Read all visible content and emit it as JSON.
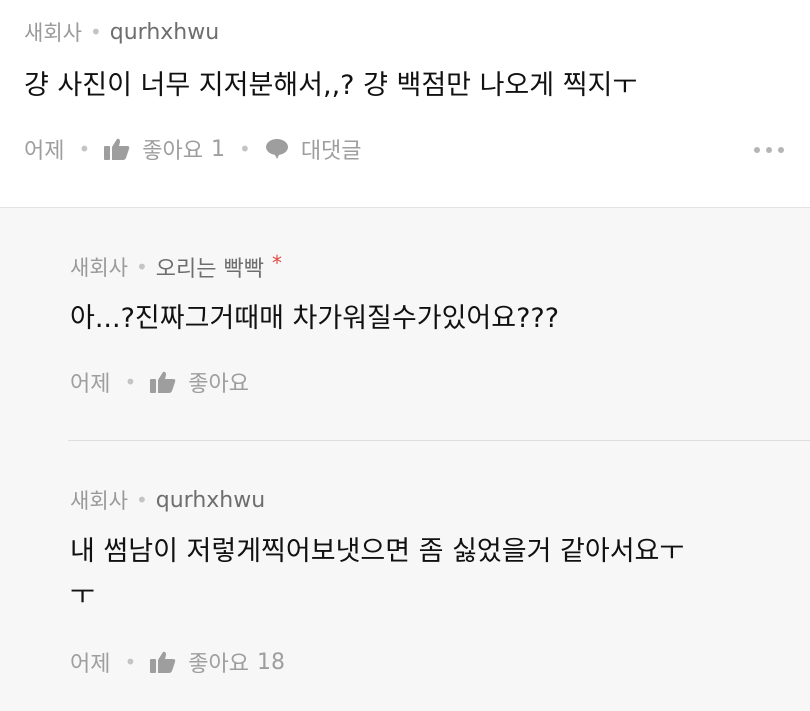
{
  "top_comment": {
    "department": "새회사",
    "nickname": "qurhxhwu",
    "text": "걍 사진이 너무 지저분해서,,? 걍 백점만 나오게 찍지ㅜ",
    "time": "어제",
    "like_label": "좋아요",
    "like_count": "1",
    "reply_label": "대댓글"
  },
  "replies": [
    {
      "department": "새회사",
      "nickname": "오리는 빡빡",
      "author_mark": "*",
      "text": "아...?진짜그거때매 차가워질수가있어요???",
      "time": "어제",
      "like_label": "좋아요"
    },
    {
      "department": "새회사",
      "nickname": "qurhxhwu",
      "text_line1": "내 썸남이 저렇게찍어보냇으면 좀 싫었을거 같아서요ㅜ",
      "text_line2": "ㅜ",
      "time": "어제",
      "like_label": "좋아요",
      "like_count": "18"
    }
  ],
  "colors": {
    "reply_background": "#f7f7f7",
    "author_mark": "#e0483f",
    "meta_text": "#9a9a9a"
  },
  "icons": [
    "thumbs-up-icon",
    "speech-bubble-icon",
    "more-options-icon"
  ]
}
